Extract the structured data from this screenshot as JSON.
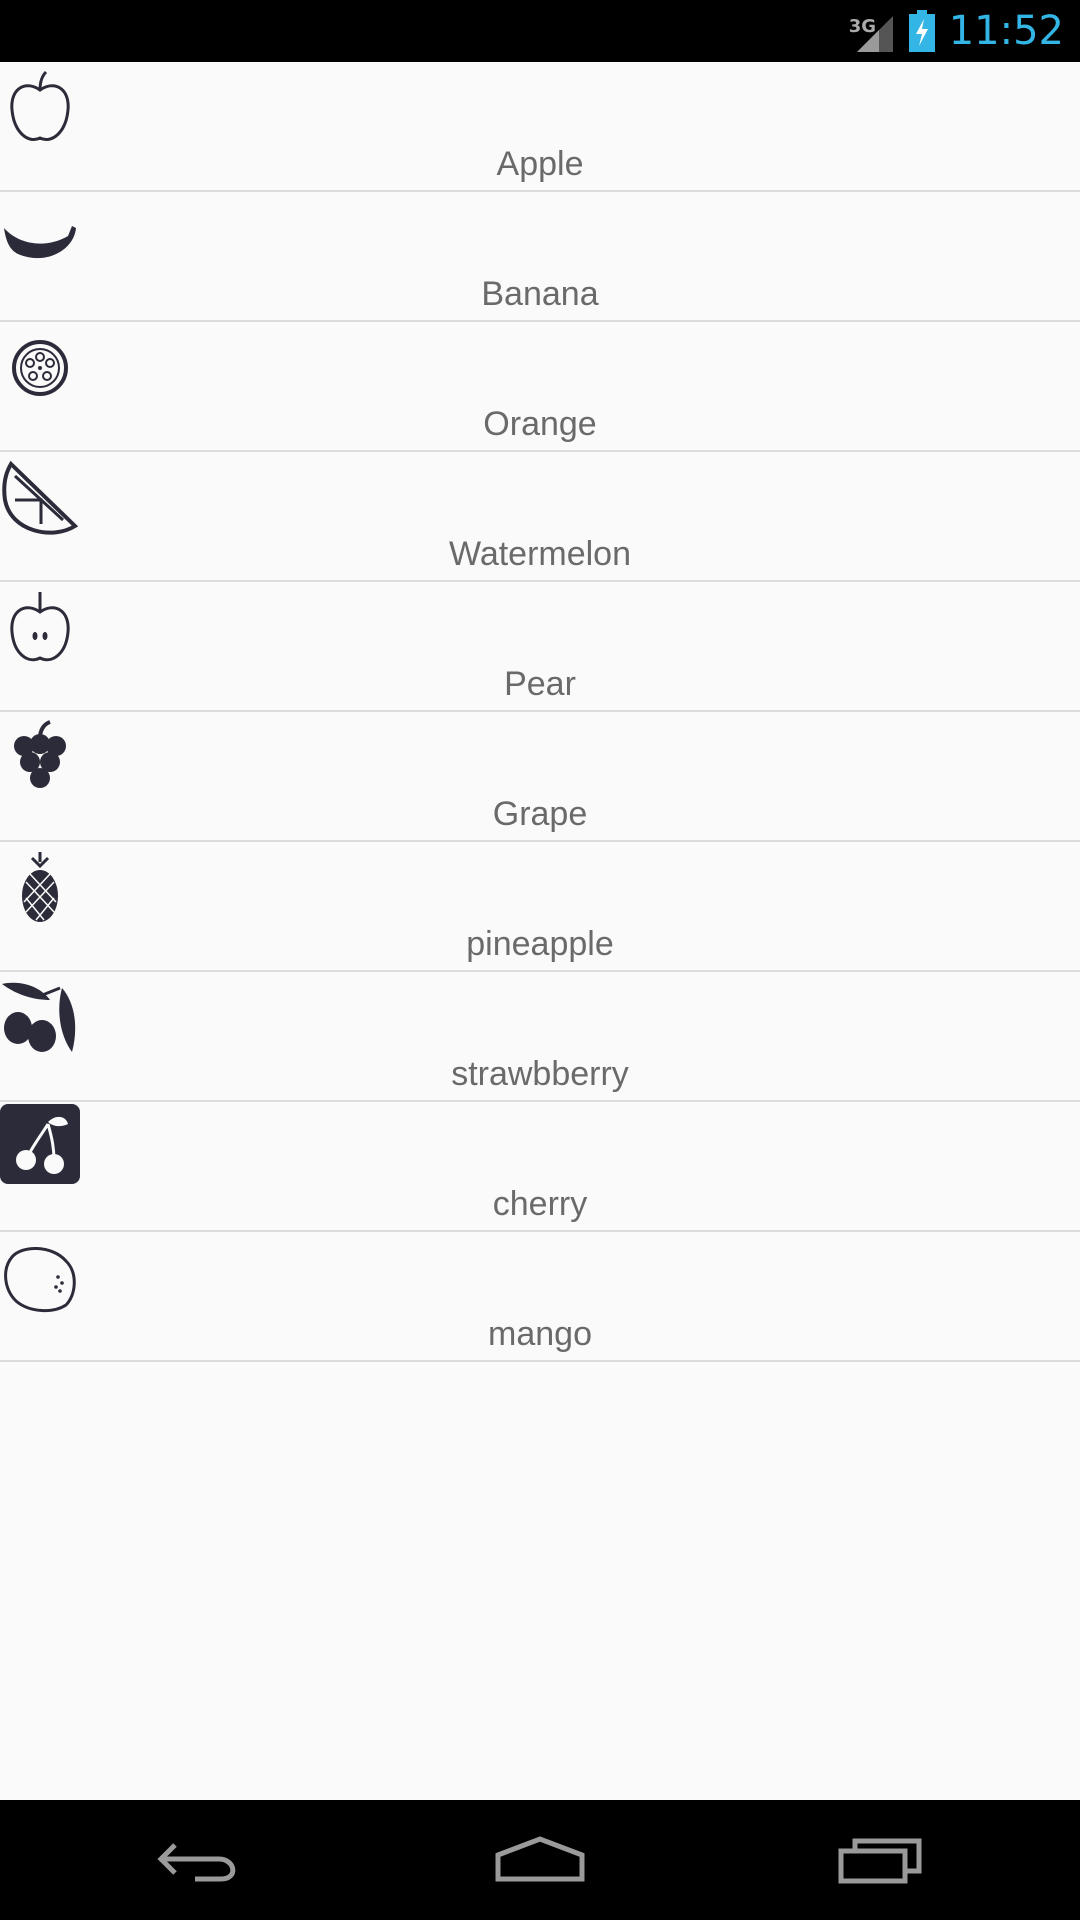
{
  "status_bar": {
    "network": "3G",
    "time": "11:52",
    "icons": [
      "signal-icon",
      "battery-charging-icon"
    ]
  },
  "fruits": [
    {
      "label": "Apple",
      "icon": "apple-icon"
    },
    {
      "label": "Banana",
      "icon": "banana-icon"
    },
    {
      "label": "Orange",
      "icon": "orange-slice-icon"
    },
    {
      "label": "Watermelon",
      "icon": "watermelon-slice-icon"
    },
    {
      "label": "Pear",
      "icon": "pear-icon"
    },
    {
      "label": "Grape",
      "icon": "grape-icon"
    },
    {
      "label": "pineapple",
      "icon": "pineapple-icon"
    },
    {
      "label": "strawbberry",
      "icon": "olive-branch-icon"
    },
    {
      "label": "cherry",
      "icon": "cherry-icon"
    },
    {
      "label": "mango",
      "icon": "lemon-icon"
    }
  ],
  "nav_bar": {
    "icons": [
      "back-icon",
      "home-icon",
      "recents-icon"
    ]
  },
  "colors": {
    "clock": "#33b5e5",
    "icon": "#2b2b3a",
    "label": "#6a6a6a",
    "divider": "#dcdcdc",
    "background": "#fafafa"
  }
}
